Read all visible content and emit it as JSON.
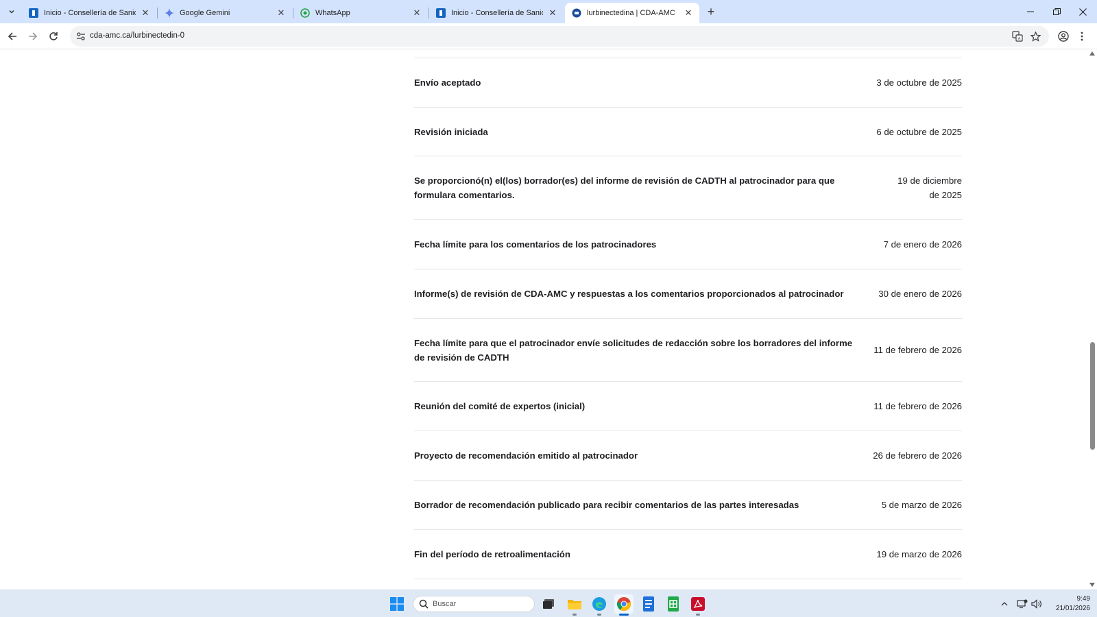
{
  "browser": {
    "tabs": [
      {
        "title": "Inicio - Consellería de Sanidade",
        "favicon": "sanidade-icon",
        "active": false
      },
      {
        "title": "Google Gemini",
        "favicon": "gemini-icon",
        "active": false
      },
      {
        "title": "WhatsApp",
        "favicon": "whatsapp-icon",
        "active": false
      },
      {
        "title": "Inicio - Consellería de Sanidade",
        "favicon": "sanidade-icon",
        "active": false
      },
      {
        "title": "lurbinectedina | CDA-AMC",
        "favicon": "cda-amc-icon",
        "active": true
      }
    ],
    "url": "cda-amc.ca/lurbinectedin-0"
  },
  "timeline": [
    {
      "label": "Envío aceptado",
      "date": "3 de octubre de 2025"
    },
    {
      "label": "Revisión iniciada",
      "date": "6 de octubre de 2025"
    },
    {
      "label": "Se proporcionó(n) el(los) borrador(es) del informe de revisión de CADTH al patrocinador para que formulara comentarios.",
      "date": "19 de diciembre de 2025"
    },
    {
      "label": "Fecha límite para los comentarios de los patrocinadores",
      "date": "7 de enero de 2026"
    },
    {
      "label": "Informe(s) de revisión de CDA-AMC y respuestas a los comentarios proporcionados al patrocinador",
      "date": "30 de enero de 2026"
    },
    {
      "label": "Fecha límite para que el patrocinador envíe solicitudes de redacción sobre los borradores del informe de revisión de CADTH",
      "date": "11 de febrero de 2026"
    },
    {
      "label": "Reunión del comité de expertos (inicial)",
      "date": "11 de febrero de 2026"
    },
    {
      "label": "Proyecto de recomendación emitido al patrocinador",
      "date": "26 de febrero de 2026"
    },
    {
      "label": "Borrador de recomendación publicado para recibir comentarios de las partes interesadas",
      "date": "5 de marzo de 2026"
    },
    {
      "label": "Fin del período de retroalimentación",
      "date": "19 de marzo de 2026"
    }
  ],
  "taskbar": {
    "search_placeholder": "Buscar",
    "time": "9:49",
    "date": "21/01/2026"
  },
  "colors": {
    "tabstrip": "#d3e3fd",
    "taskbar": "#dfe9f5",
    "accent": "#0a64c8"
  }
}
